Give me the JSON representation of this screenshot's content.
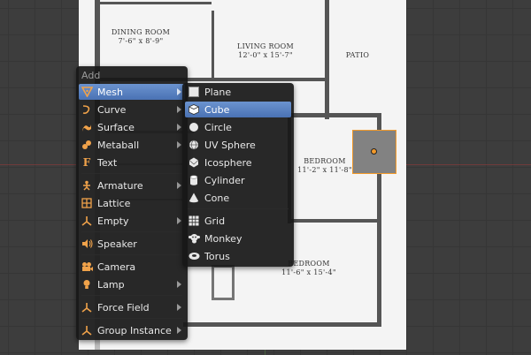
{
  "plan": {
    "rooms": [
      {
        "name": "DINING ROOM",
        "size": "7'-6\" x 8'-9\""
      },
      {
        "name": "LIVING ROOM",
        "size": "12'-0\" x 15'-7\""
      },
      {
        "name": "PATIO",
        "size": ""
      },
      {
        "name": "BEDROOM",
        "size": "11'-2\" x 11'-8\""
      },
      {
        "name": "BEDROOM",
        "size": "11'-6\" x 15'-4\""
      }
    ]
  },
  "add_menu": {
    "title": "Add",
    "items": [
      {
        "label": "Mesh",
        "icon": "mesh-icon",
        "submenu": true
      },
      {
        "label": "Curve",
        "icon": "curve-icon",
        "submenu": true
      },
      {
        "label": "Surface",
        "icon": "surface-icon",
        "submenu": true
      },
      {
        "label": "Metaball",
        "icon": "metaball-icon",
        "submenu": true
      },
      {
        "label": "Text",
        "icon": "text-icon",
        "submenu": false
      },
      {
        "label": "Armature",
        "icon": "armature-icon",
        "submenu": true
      },
      {
        "label": "Lattice",
        "icon": "lattice-icon",
        "submenu": false
      },
      {
        "label": "Empty",
        "icon": "empty-icon",
        "submenu": true
      },
      {
        "label": "Speaker",
        "icon": "speaker-icon",
        "submenu": false
      },
      {
        "label": "Camera",
        "icon": "camera-icon",
        "submenu": false
      },
      {
        "label": "Lamp",
        "icon": "lamp-icon",
        "submenu": true
      },
      {
        "label": "Force Field",
        "icon": "force-field-icon",
        "submenu": true
      },
      {
        "label": "Group Instance",
        "icon": "group-instance-icon",
        "submenu": true
      }
    ],
    "highlighted": "Mesh"
  },
  "mesh_menu": {
    "items": [
      {
        "label": "Plane",
        "icon": "plane-icon"
      },
      {
        "label": "Cube",
        "icon": "cube-icon"
      },
      {
        "label": "Circle",
        "icon": "circle-icon"
      },
      {
        "label": "UV Sphere",
        "icon": "uv-sphere-icon"
      },
      {
        "label": "Icosphere",
        "icon": "icosphere-icon"
      },
      {
        "label": "Cylinder",
        "icon": "cylinder-icon"
      },
      {
        "label": "Cone",
        "icon": "cone-icon"
      },
      {
        "label": "Grid",
        "icon": "grid-icon"
      },
      {
        "label": "Monkey",
        "icon": "monkey-icon"
      },
      {
        "label": "Torus",
        "icon": "torus-icon"
      }
    ],
    "highlighted": "Cube"
  },
  "colors": {
    "accent": "#5680c2",
    "selection": "#f39a2a",
    "menu_bg": "#181818",
    "icon_orange": "#f0a24a"
  }
}
